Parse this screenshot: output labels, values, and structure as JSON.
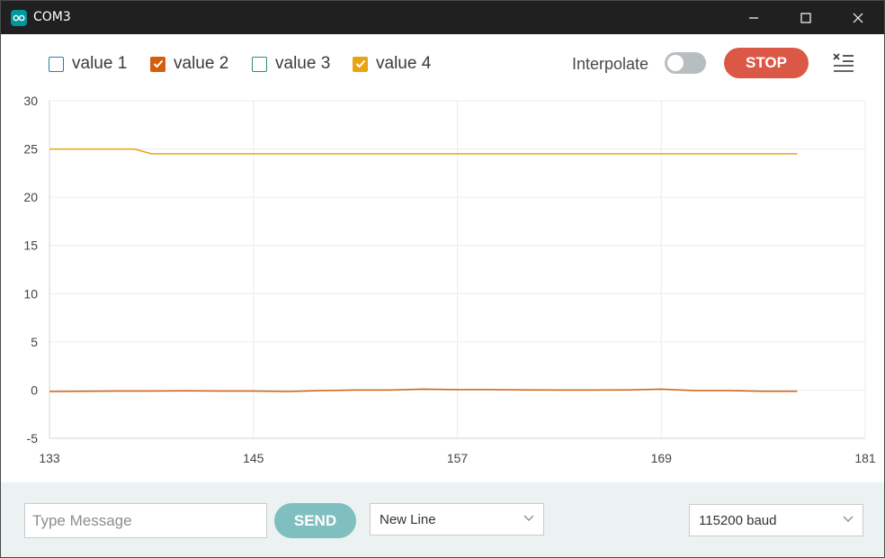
{
  "window": {
    "title": "COM3"
  },
  "legend": {
    "items": [
      {
        "label": "value 1",
        "checked": false,
        "color": "#2b7ea0"
      },
      {
        "label": "value 2",
        "checked": true,
        "color": "#d35f0f"
      },
      {
        "label": "value 3",
        "checked": false,
        "color": "#2b8a80"
      },
      {
        "label": "value 4",
        "checked": true,
        "color": "#e8a413"
      }
    ]
  },
  "controls": {
    "interpolate_label": "Interpolate",
    "interpolate_on": false,
    "stop_label": "STOP"
  },
  "footer": {
    "message_placeholder": "Type Message",
    "send_label": "SEND",
    "line_ending": "New Line",
    "baud_rate": "115200 baud"
  },
  "chart_data": {
    "type": "line",
    "x_ticks": [
      133,
      145,
      157,
      169,
      181
    ],
    "y_ticks": [
      -5,
      0,
      5,
      10,
      15,
      20,
      25,
      30
    ],
    "xlim": [
      133,
      181
    ],
    "ylim": [
      -5,
      30
    ],
    "grid": true,
    "series": [
      {
        "name": "value 2",
        "color": "#d35f0f",
        "x": [
          133,
          135,
          137,
          139,
          141,
          143,
          145,
          147,
          149,
          151,
          153,
          155,
          157,
          159,
          161,
          163,
          165,
          167,
          169,
          171,
          173,
          175,
          177
        ],
        "y": [
          -0.15,
          -0.12,
          -0.1,
          -0.1,
          -0.08,
          -0.1,
          -0.1,
          -0.15,
          -0.05,
          0.0,
          0.0,
          0.1,
          0.05,
          0.05,
          0.02,
          0.0,
          0.0,
          0.02,
          0.1,
          -0.05,
          -0.05,
          -0.12,
          -0.12
        ]
      },
      {
        "name": "value 4",
        "color": "#e8a413",
        "x": [
          133,
          138,
          139,
          145,
          157,
          169,
          177
        ],
        "y": [
          25.0,
          25.0,
          24.5,
          24.5,
          24.5,
          24.5,
          24.5
        ]
      }
    ]
  }
}
